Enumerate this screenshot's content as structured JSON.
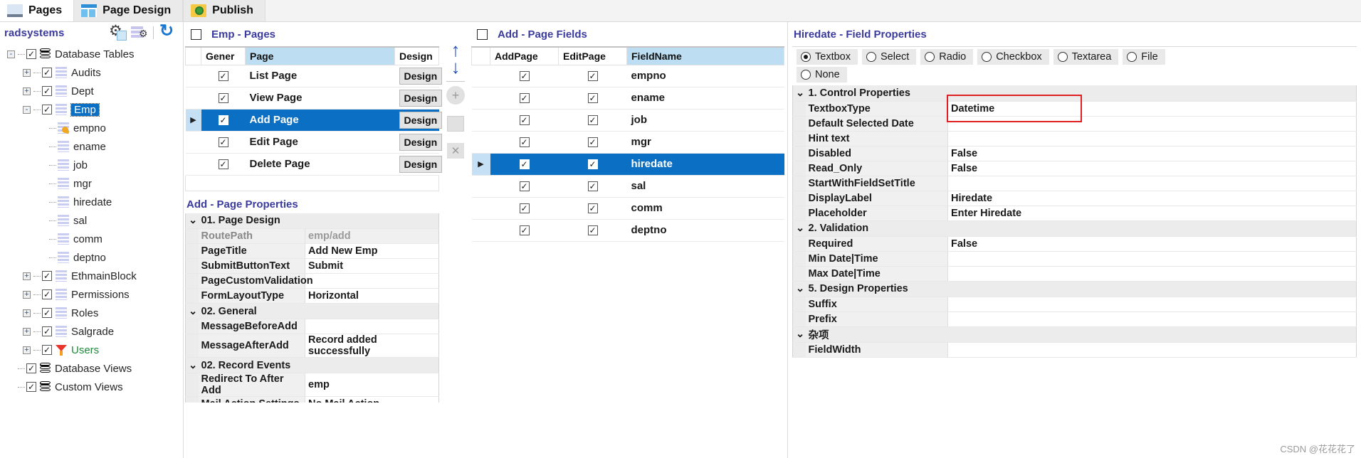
{
  "ribbon": {
    "tabs": [
      {
        "label": "Pages",
        "icon": "pages-icon",
        "active": true
      },
      {
        "label": "Page Design",
        "icon": "page-design-icon",
        "active": false
      },
      {
        "label": "Publish",
        "icon": "publish-icon",
        "active": false
      }
    ]
  },
  "tree": {
    "title": "radsystems",
    "tools": [
      {
        "name": "settings-gear-icon",
        "label": ""
      },
      {
        "name": "list-settings-icon",
        "label": ""
      },
      {
        "name": "refresh-icon",
        "label": ""
      }
    ],
    "nodes": [
      {
        "label": "Database Tables",
        "depth": 0,
        "expander": "-",
        "icon": "database-icon",
        "checked": true
      },
      {
        "label": "Audits",
        "depth": 1,
        "expander": "+",
        "icon": "table-icon",
        "checked": true
      },
      {
        "label": "Dept",
        "depth": 1,
        "expander": "+",
        "icon": "table-icon",
        "checked": true
      },
      {
        "label": "Emp",
        "depth": 1,
        "expander": "-",
        "icon": "table-icon",
        "checked": true,
        "selected": true
      },
      {
        "label": "empno",
        "depth": 2,
        "expander": "",
        "icon": "table-key-icon",
        "checked": null
      },
      {
        "label": "ename",
        "depth": 2,
        "expander": "",
        "icon": "table-icon",
        "checked": null
      },
      {
        "label": "job",
        "depth": 2,
        "expander": "",
        "icon": "table-icon",
        "checked": null
      },
      {
        "label": "mgr",
        "depth": 2,
        "expander": "",
        "icon": "table-icon",
        "checked": null
      },
      {
        "label": "hiredate",
        "depth": 2,
        "expander": "",
        "icon": "table-icon",
        "checked": null
      },
      {
        "label": "sal",
        "depth": 2,
        "expander": "",
        "icon": "table-icon",
        "checked": null
      },
      {
        "label": "comm",
        "depth": 2,
        "expander": "",
        "icon": "table-icon",
        "checked": null
      },
      {
        "label": "deptno",
        "depth": 2,
        "expander": "",
        "icon": "table-icon",
        "checked": null
      },
      {
        "label": "EthmainBlock",
        "depth": 1,
        "expander": "+",
        "icon": "table-icon",
        "checked": true
      },
      {
        "label": "Permissions",
        "depth": 1,
        "expander": "+",
        "icon": "table-icon",
        "checked": true
      },
      {
        "label": "Roles",
        "depth": 1,
        "expander": "+",
        "icon": "table-icon",
        "checked": true
      },
      {
        "label": "Salgrade",
        "depth": 1,
        "expander": "+",
        "icon": "table-icon",
        "checked": true
      },
      {
        "label": "Users",
        "depth": 1,
        "expander": "+",
        "icon": "filter-icon",
        "checked": true,
        "green": true
      },
      {
        "label": "Database Views",
        "depth": 0,
        "expander": "",
        "icon": "database-icon",
        "checked": true
      },
      {
        "label": "Custom Views",
        "depth": 0,
        "expander": "",
        "icon": "database-icon",
        "checked": true
      }
    ]
  },
  "pages_panel": {
    "title": "Emp - Pages",
    "toolbar": [
      {
        "name": "new-page-icon"
      },
      {
        "name": "copy-page-icon"
      },
      {
        "name": "delete-page-icon"
      }
    ],
    "columns": [
      "",
      "Gener",
      "Page",
      "Design"
    ],
    "rows": [
      {
        "generate": true,
        "page": "List Page",
        "design": "Design",
        "selected": false
      },
      {
        "generate": true,
        "page": "View Page",
        "design": "Design",
        "selected": false
      },
      {
        "generate": true,
        "page": "Add Page",
        "design": "Design",
        "selected": true
      },
      {
        "generate": true,
        "page": "Edit Page",
        "design": "Design",
        "selected": false
      },
      {
        "generate": true,
        "page": "Delete Page",
        "design": "Design",
        "selected": false
      }
    ]
  },
  "page_properties": {
    "title": "Add - Page Properties",
    "groups": [
      {
        "name": "01. Page Design",
        "rows": [
          {
            "name": "RoutePath",
            "value": "emp/add",
            "readonly": true
          },
          {
            "name": "PageTitle",
            "value": "Add New Emp"
          },
          {
            "name": "SubmitButtonText",
            "value": "Submit"
          },
          {
            "name": "PageCustomValidation",
            "value": ""
          },
          {
            "name": "FormLayoutType",
            "value": "Horizontal"
          }
        ]
      },
      {
        "name": "02. General",
        "rows": [
          {
            "name": "MessageBeforeAdd",
            "value": ""
          },
          {
            "name": "MessageAfterAdd",
            "value": "Record added successfully"
          }
        ]
      },
      {
        "name": "02. Record Events",
        "rows": [
          {
            "name": "Redirect To After Add",
            "value": "emp"
          },
          {
            "name": "Mail Action Settings",
            "value": "No Mail Action"
          }
        ]
      }
    ]
  },
  "reorder": {
    "up": "↑",
    "down": "↓",
    "add": "+",
    "edit": "",
    "remove": "✕"
  },
  "fields_panel": {
    "title": "Add - Page Fields",
    "columns": [
      "",
      "AddPage",
      "EditPage",
      "FieldName"
    ],
    "rows": [
      {
        "add": true,
        "edit": true,
        "field": "empno",
        "selected": false
      },
      {
        "add": true,
        "edit": true,
        "field": "ename",
        "selected": false
      },
      {
        "add": true,
        "edit": true,
        "field": "job",
        "selected": false
      },
      {
        "add": true,
        "edit": true,
        "field": "mgr",
        "selected": false
      },
      {
        "add": true,
        "edit": true,
        "field": "hiredate",
        "selected": true
      },
      {
        "add": true,
        "edit": true,
        "field": "sal",
        "selected": false
      },
      {
        "add": true,
        "edit": true,
        "field": "comm",
        "selected": false
      },
      {
        "add": true,
        "edit": true,
        "field": "deptno",
        "selected": false
      }
    ]
  },
  "field_properties": {
    "title": "Hiredate - Field Properties",
    "control_types": [
      {
        "label": "Textbox",
        "selected": true
      },
      {
        "label": "Select",
        "selected": false
      },
      {
        "label": "Radio",
        "selected": false
      },
      {
        "label": "Checkbox",
        "selected": false
      },
      {
        "label": "Textarea",
        "selected": false
      },
      {
        "label": "File",
        "selected": false
      },
      {
        "label": "None",
        "selected": false
      }
    ],
    "groups": [
      {
        "name": "1. Control Properties",
        "rows": [
          {
            "name": "TextboxType",
            "value": "Datetime",
            "highlight": true
          },
          {
            "name": "Default Selected Date",
            "value": ""
          },
          {
            "name": "Hint text",
            "value": ""
          },
          {
            "name": "Disabled",
            "value": "False"
          },
          {
            "name": "Read_Only",
            "value": "False"
          },
          {
            "name": "StartWithFieldSetTitle",
            "value": ""
          },
          {
            "name": "DisplayLabel",
            "value": "Hiredate"
          },
          {
            "name": "Placeholder",
            "value": "Enter Hiredate"
          }
        ]
      },
      {
        "name": "2. Validation",
        "rows": [
          {
            "name": "Required",
            "value": "False"
          },
          {
            "name": "Min Date|Time",
            "value": ""
          },
          {
            "name": "Max Date|Time",
            "value": ""
          }
        ]
      },
      {
        "name": "5. Design Properties",
        "rows": [
          {
            "name": "Suffix",
            "value": ""
          },
          {
            "name": "Prefix",
            "value": ""
          }
        ]
      },
      {
        "name": "杂项",
        "rows": [
          {
            "name": "FieldWidth",
            "value": ""
          }
        ]
      }
    ],
    "highlight_color": "#e02020"
  },
  "watermark": "CSDN @花花花了"
}
